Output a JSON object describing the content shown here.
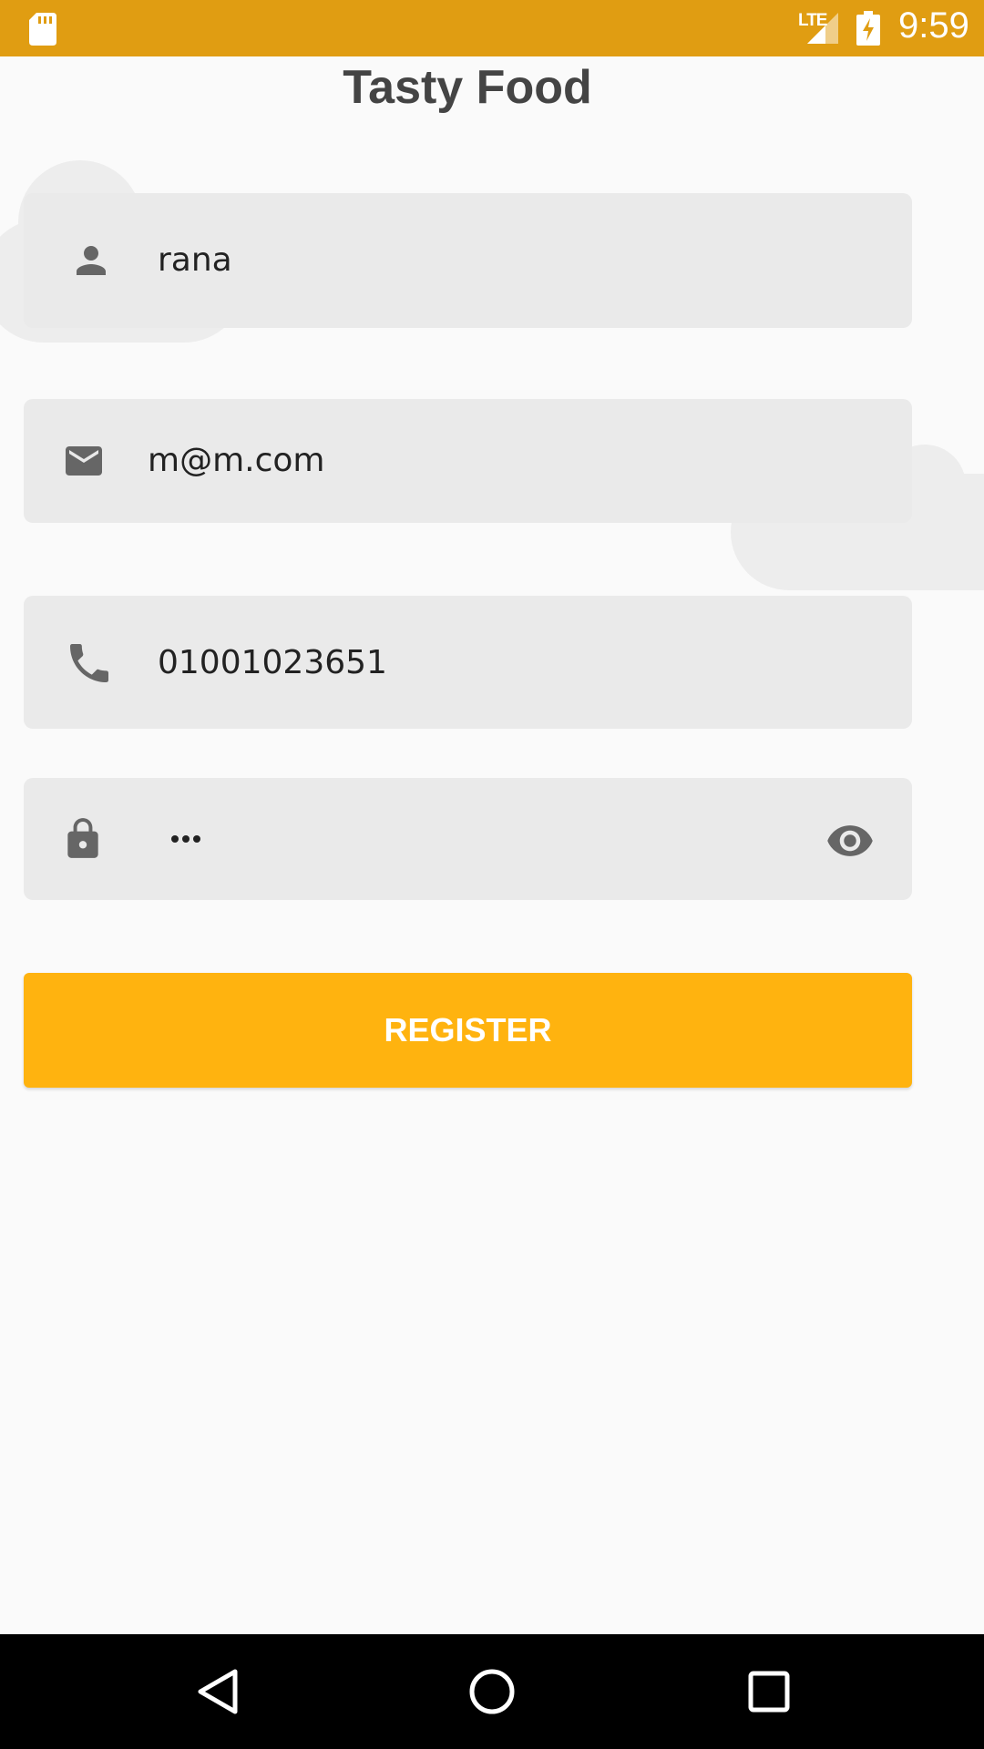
{
  "status_bar": {
    "network_type": "LTE",
    "time": "9:59",
    "icons": [
      "sd-card-icon",
      "signal-icon",
      "battery-charging-icon"
    ]
  },
  "app": {
    "title": "Tasty Food"
  },
  "form": {
    "name": {
      "value": "rana",
      "icon": "person-icon"
    },
    "email": {
      "value": "m@m.com",
      "icon": "mail-icon"
    },
    "phone": {
      "value": "01001023651",
      "icon": "phone-icon"
    },
    "password": {
      "masked_length": 3,
      "icon": "lock-icon",
      "toggle_icon": "eye-icon"
    },
    "register_label": "REGISTER"
  },
  "colors": {
    "status_bar": "#e09d12",
    "accent": "#ffb30f",
    "field_background": "#eaeaea",
    "background": "#fafafa"
  },
  "nav_bar": {
    "buttons": [
      "back-icon",
      "home-icon",
      "recents-icon"
    ]
  }
}
